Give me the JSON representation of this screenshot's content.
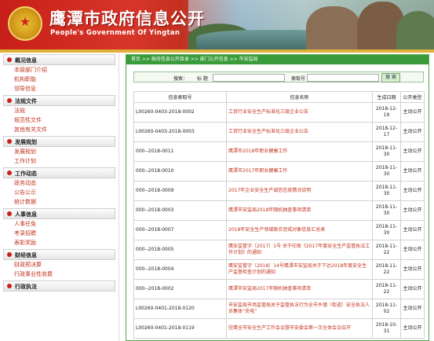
{
  "header": {
    "title_cn": "鹰潭市政府信息公开",
    "title_en": "People's Government Of Yingtan"
  },
  "sidebar": {
    "sections": [
      {
        "title": "概况信息",
        "items": [
          "本级部门介绍",
          "机构职能",
          "领导信息"
        ]
      },
      {
        "title": "法规文件",
        "items": [
          "法规",
          "规范性文件",
          "其他有关文件"
        ]
      },
      {
        "title": "发展规划",
        "items": [
          "发展规划",
          "工作计划"
        ]
      },
      {
        "title": "工作动态",
        "items": [
          "政务动态",
          "公告公示",
          "统计数据"
        ]
      },
      {
        "title": "人事信息",
        "items": [
          "人事任免",
          "考录招聘",
          "表彰奖励"
        ]
      },
      {
        "title": "财经信息",
        "items": [
          "财政预决算",
          "行政事业性收费"
        ]
      },
      {
        "title": "行政执法",
        "items": []
      }
    ]
  },
  "main": {
    "breadcrumb": "首页 >> 政府信息公开目录 >> 部门公开信息 >> 市安监局",
    "search": {
      "label": "搜索：",
      "title_label": "标 题",
      "index_label": "索取号",
      "button": "搜 索"
    },
    "table": {
      "headers": [
        "信息索取号",
        "信息名称",
        "生成日期",
        "公开类型"
      ],
      "rows": [
        [
          "L00260-0403-2018-0002",
          "工贸行业安全生产标准化三级企业公告",
          "2018-12-19",
          "主动公开"
        ],
        [
          "L00260-0403-2018-0003",
          "工贸行业安全生产标准化三级企业公告",
          "2018-12-17",
          "主动公开"
        ],
        [
          "000--2018-0011",
          "鹰潭市2018年职业健康工作",
          "2018-11-30",
          "主动公开"
        ],
        [
          "000--2018-0010",
          "鹰潭市2017年职业健康工作",
          "2018-11-30",
          "主动公开"
        ],
        [
          "000--2018-0009",
          "2017年企业安全生产诚信信息情况说明",
          "2018-11-30",
          "主动公开"
        ],
        [
          "000--2018-0003",
          "鹰潭市安监局2018年随机抽查事项清单",
          "2018-11-30",
          "主动公开"
        ],
        [
          "000--2018-0007",
          "2018年安全生产领域联合惩戒对象信息汇总表",
          "2018-11-30",
          "主动公开"
        ],
        [
          "000--2018-0005",
          "鹰安监管字〔2017〕1号 关于印发《2017年度安全生产监管执法工作计划》的通知",
          "2018-11-22",
          "主动公开"
        ],
        [
          "000--2018-0004",
          "鹰安监管字〔2018〕14号鹰潭市安监局关于下达2018年度安全生产监督检查计划的通知",
          "2018-11-22",
          "主动公开"
        ],
        [
          "000--2018-0002",
          "鹰潭市安监局2017年随机抽查事项清单",
          "2018-11-22",
          "主动公开"
        ],
        [
          "L00260-0401-2018-0120",
          "市安监局市场监管局关于监管执法行为全市乡镇（街道）安全执法人员集体“充电”",
          "2018-11-02",
          "主动公开"
        ],
        [
          "L00260-0401-2018-0119",
          "驻鹰全市安全生产工作会议暨市安委会第一次全体会议召开",
          "2018-10-31",
          "主动公开"
        ]
      ]
    }
  },
  "colors": {
    "brand_red": "#c71f17",
    "nav_green": "#3a9b3a",
    "link_red": "#c3341e",
    "gold": "#e1b23a"
  }
}
